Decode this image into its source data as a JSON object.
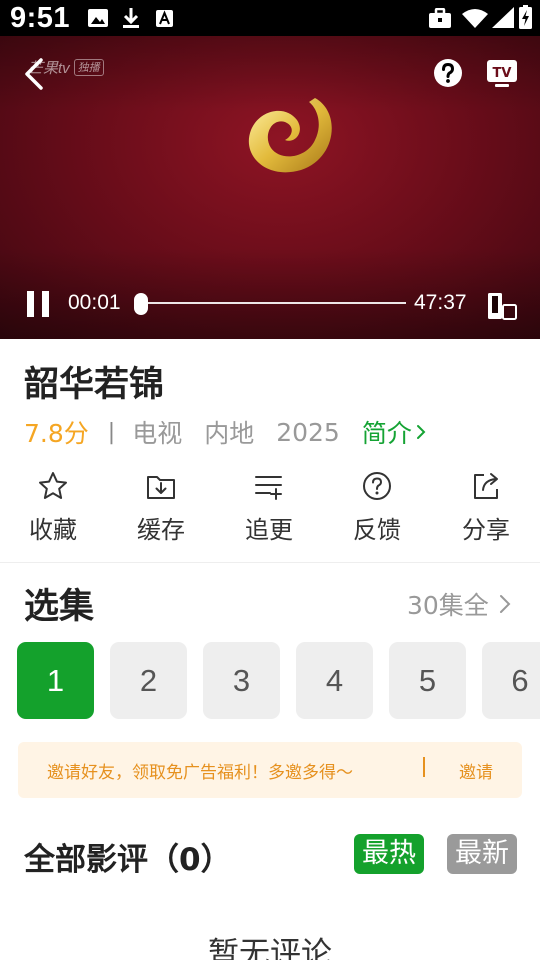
{
  "status_bar": {
    "time": "9:51",
    "icons": [
      "image-icon",
      "download-icon",
      "font-a-icon",
      "briefcase-icon",
      "wifi-icon",
      "signal-icon",
      "battery-charging-icon"
    ]
  },
  "player": {
    "logo_text": "芒果tv",
    "logo_badge": "独播",
    "current_time": "00:01",
    "total_time": "47:37",
    "progress": 0.0004,
    "state": "playing",
    "icons": [
      "back-icon",
      "help-icon",
      "tv-cast-icon",
      "pause-icon",
      "screen-rotate-icon"
    ]
  },
  "show": {
    "title": "韶华若锦",
    "score": "7.8分",
    "separator": "|",
    "type": "电视",
    "region": "内地",
    "year": "2025",
    "intro_label": "简介"
  },
  "actions": [
    {
      "label": "收藏",
      "icon": "star-icon"
    },
    {
      "label": "缓存",
      "icon": "download-folder-icon"
    },
    {
      "label": "追更",
      "icon": "playlist-add-icon"
    },
    {
      "label": "反馈",
      "icon": "help-circle-icon"
    },
    {
      "label": "分享",
      "icon": "share-icon"
    }
  ],
  "episodes": {
    "title": "选集",
    "total_label": "30集全",
    "items": [
      "1",
      "2",
      "3",
      "4",
      "5",
      "6"
    ],
    "selected": "1"
  },
  "invite": {
    "text": "邀请好友，领取免广告福利！多邀多得～",
    "separator": "|",
    "link_label": "邀请"
  },
  "reviews": {
    "title": "全部影评（0）",
    "sort_hot": "最热",
    "sort_new": "最新",
    "empty_text": "暂无评论"
  },
  "colors": {
    "accent_green": "#14a12c",
    "score_orange": "#f5a623",
    "invite_orange": "#e6911f",
    "invite_bg": "#fff4e5",
    "player_bg": "#6b0d1a"
  }
}
